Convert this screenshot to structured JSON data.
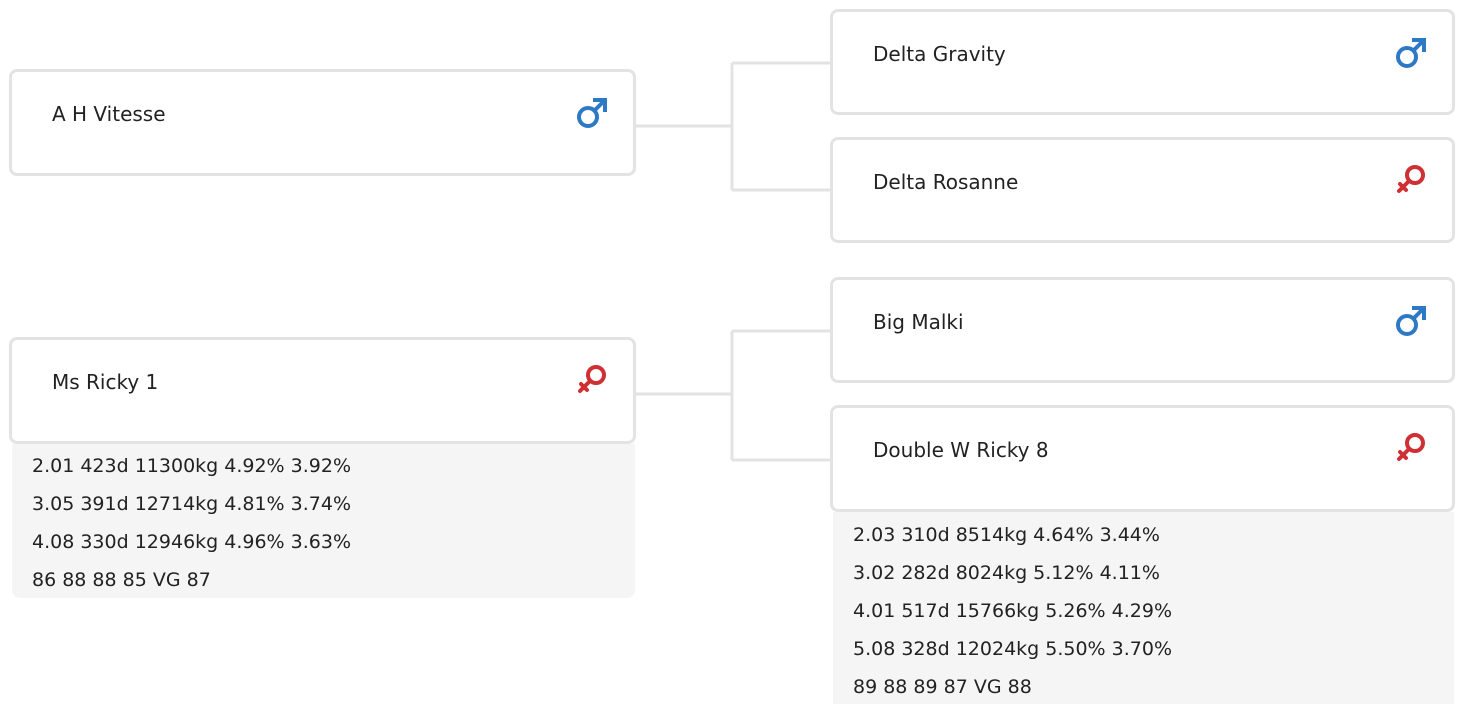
{
  "colors": {
    "male": "#2e79c6",
    "female": "#cf3033",
    "border": "#e3e3e3",
    "stats_background": "#f5f5f5"
  },
  "parents": {
    "sire": {
      "name": "A H Vitesse",
      "sex": "male",
      "icon": "male-symbol-icon"
    },
    "dam": {
      "name": "Ms Ricky 1",
      "sex": "female",
      "icon": "female-symbol-icon",
      "stats": [
        "2.01 423d 11300kg 4.92% 3.92%",
        "3.05 391d 12714kg 4.81% 3.74%",
        "4.08 330d 12946kg 4.96% 3.63%",
        "86 88 88 85 VG 87"
      ]
    }
  },
  "grandparents": {
    "sire_sire": {
      "name": "Delta Gravity",
      "sex": "male",
      "icon": "male-symbol-icon"
    },
    "sire_dam": {
      "name": "Delta Rosanne",
      "sex": "female",
      "icon": "female-symbol-icon"
    },
    "dam_sire": {
      "name": "Big Malki",
      "sex": "male",
      "icon": "male-symbol-icon"
    },
    "dam_dam": {
      "name": "Double W Ricky 8",
      "sex": "female",
      "icon": "female-symbol-icon",
      "stats": [
        "2.03 310d 8514kg 4.64% 3.44%",
        "3.02 282d 8024kg 5.12% 4.11%",
        "4.01 517d 15766kg 5.26% 4.29%",
        "5.08 328d 12024kg 5.50% 3.70%",
        "89 88 89 87 VG 88"
      ]
    }
  }
}
